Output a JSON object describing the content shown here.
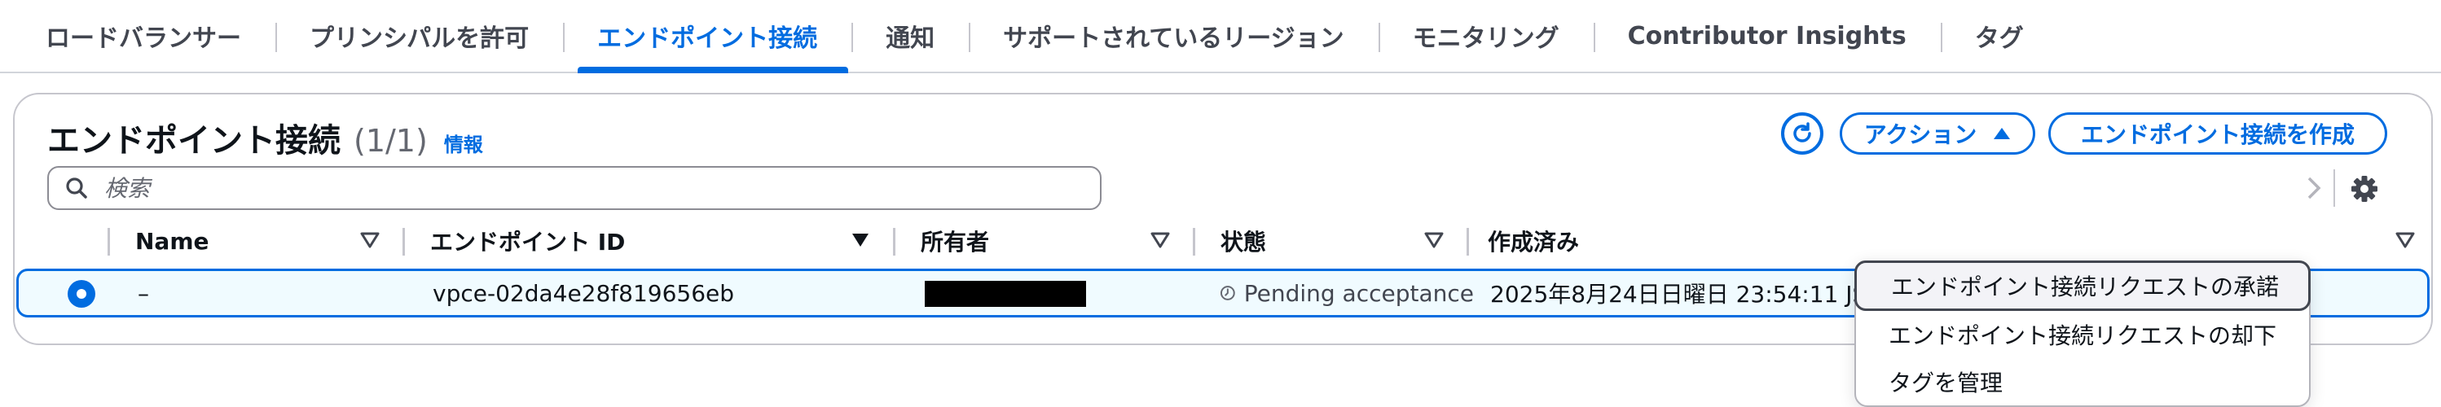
{
  "tabs": [
    {
      "label": "ロードバランサー"
    },
    {
      "label": "プリンシパルを許可"
    },
    {
      "label": "エンドポイント接続"
    },
    {
      "label": "通知"
    },
    {
      "label": "サポートされているリージョン"
    },
    {
      "label": "モニタリング"
    },
    {
      "label": "Contributor Insights"
    },
    {
      "label": "タグ"
    }
  ],
  "active_tab": "エンドポイント接続",
  "panel": {
    "title": "エンドポイント接続",
    "count": "(1/1)",
    "info": "情報",
    "actions_label": "アクション",
    "create_label": "エンドポイント接続を作成",
    "search_placeholder": "検索"
  },
  "table": {
    "columns": [
      "Name",
      "エンドポイント ID",
      "所有者",
      "状態",
      "作成済み"
    ],
    "rows": [
      {
        "selected": true,
        "name": "–",
        "endpoint_id": "vpce-02da4e28f819656eb",
        "owner": "",
        "state": "Pending acceptance",
        "created": "2025年8月24日日曜日 23:54:11 JS"
      }
    ]
  },
  "actions_menu": [
    {
      "label": "エンドポイント接続リクエストの承諾",
      "highlighted": true
    },
    {
      "label": "エンドポイント接続リクエストの却下",
      "highlighted": false
    },
    {
      "label": "タグを管理",
      "highlighted": false
    }
  ],
  "colors": {
    "accent": "#006ce0",
    "selected_row_bg": "#f0fbff",
    "border": "#c6c6cd",
    "text": "#0f141a"
  }
}
